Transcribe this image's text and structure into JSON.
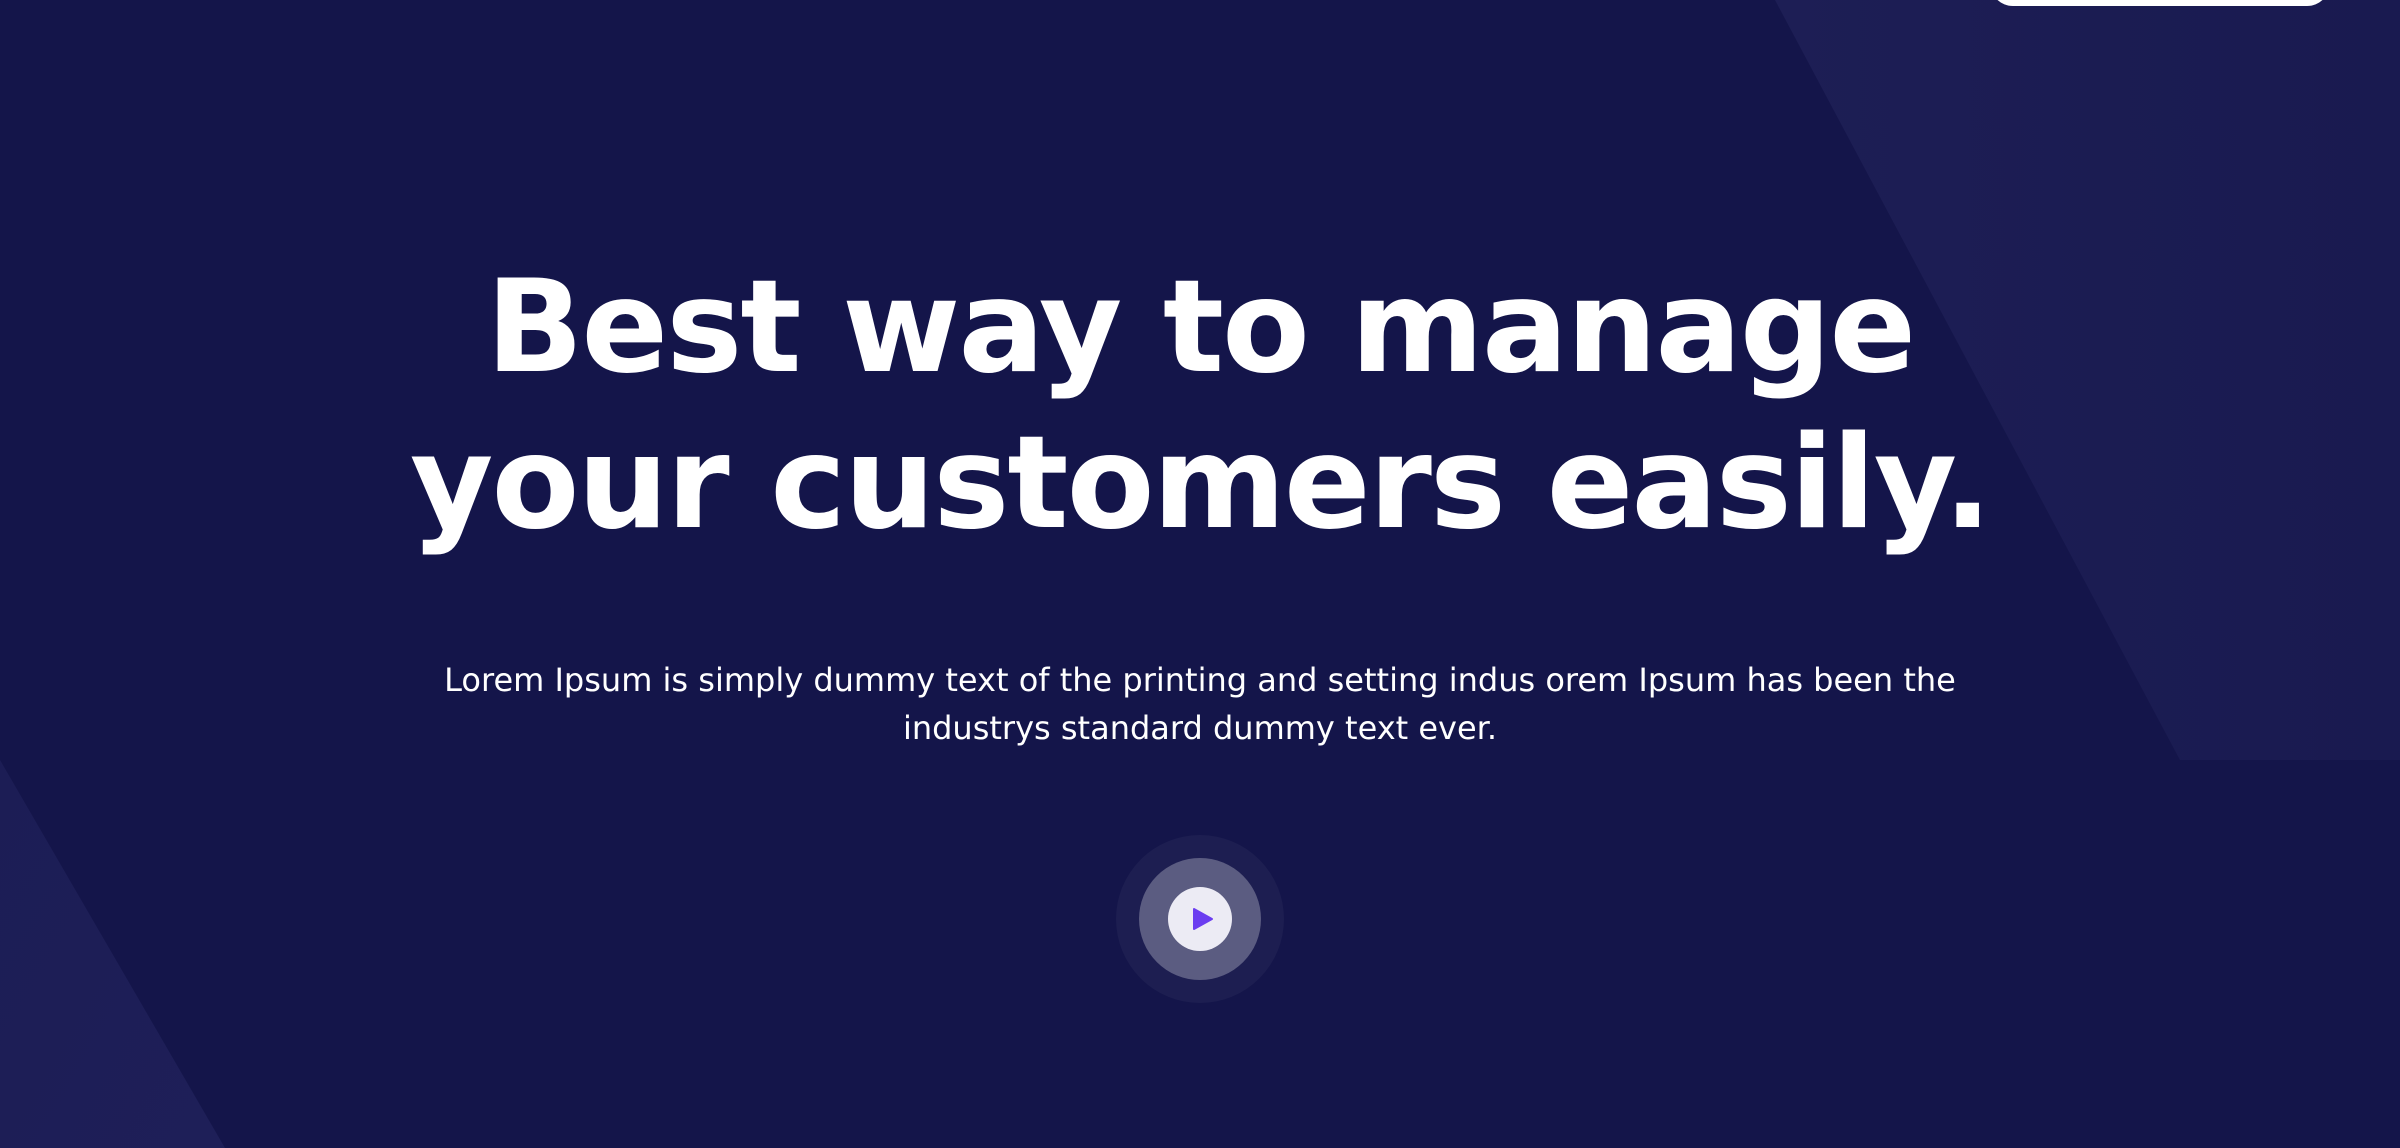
{
  "hero": {
    "headline_line1": "Best way to manage",
    "headline_line2": "your customers easily.",
    "subtext_line1": "Lorem Ipsum is simply dummy text of the printing and setting indus orem Ipsum has been the",
    "subtext_line2": "industrys standard dummy text ever."
  },
  "play_button": {
    "icon": "play-icon",
    "accent_color": "#6b3df0"
  },
  "colors": {
    "background": "#14154a",
    "shape": "#1c1d55",
    "text": "#ffffff"
  }
}
